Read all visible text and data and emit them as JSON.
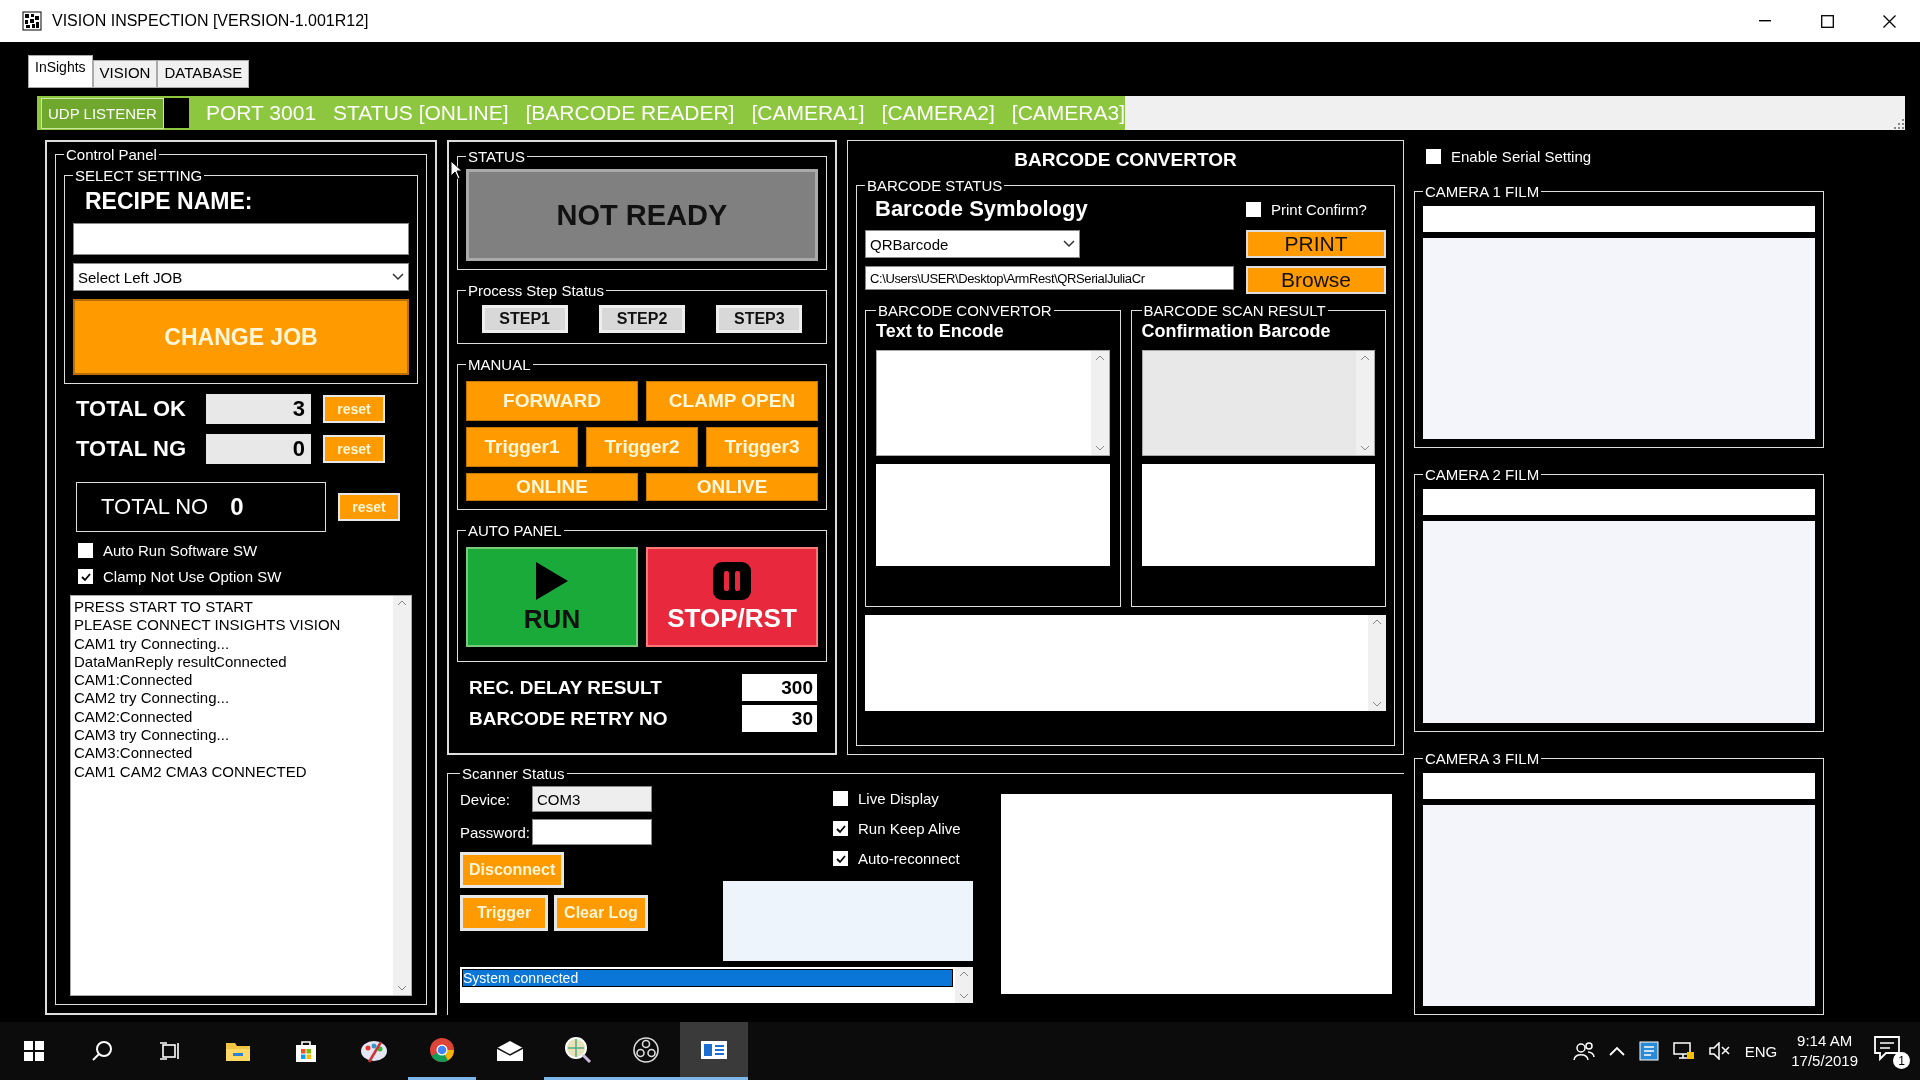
{
  "window": {
    "title": "VISION INSPECTION [VERSION-1.001R12]"
  },
  "tabs": [
    {
      "label": "InSights",
      "selected": true
    },
    {
      "label": "VISION",
      "selected": false
    },
    {
      "label": "DATABASE",
      "selected": false
    }
  ],
  "status_strip": {
    "badge": "UDP LISTENER",
    "items": [
      "PORT 3001",
      "STATUS [ONLINE]",
      "[BARCODE READER]",
      "[CAMERA1]",
      "[CAMERA2]",
      "[CAMERA3]"
    ]
  },
  "control_panel": {
    "title": "Control Panel",
    "select_setting": {
      "title": "SELECT SETTING",
      "recipe_label": "RECIPE NAME:",
      "job_select": "Select Left JOB",
      "change_job": "CHANGE JOB"
    },
    "counters": [
      {
        "label": "TOTAL OK",
        "value": "3",
        "reset": "reset"
      },
      {
        "label": "TOTAL NG",
        "value": "0",
        "reset": "reset"
      }
    ],
    "total_no": {
      "label": "TOTAL NO",
      "value": "0",
      "reset": "reset"
    },
    "options": [
      {
        "label": "Auto Run Software SW",
        "checked": false
      },
      {
        "label": "Clamp Not Use Option SW",
        "checked": true
      }
    ],
    "log": [
      "PRESS START TO START",
      "PLEASE CONNECT INSIGHTS VISION",
      "CAM1 try Connecting...",
      "DataManReply resultConnected",
      "CAM1:Connected",
      "CAM2 try Connecting...",
      "CAM2:Connected",
      "CAM3 try Connecting...",
      "CAM3:Connected",
      "CAM1 CAM2 CMA3 CONNECTED"
    ]
  },
  "status_panel": {
    "title": "STATUS",
    "status": "NOT READY",
    "process": {
      "title": "Process Step Status",
      "steps": [
        "STEP1",
        "STEP2",
        "STEP3"
      ]
    },
    "manual": {
      "title": "MANUAL",
      "rows": [
        [
          "FORWARD",
          "CLAMP OPEN"
        ],
        [
          "Trigger1",
          "Trigger2",
          "Trigger3"
        ],
        [
          "ONLINE",
          "ONLIVE"
        ]
      ]
    },
    "auto": {
      "title": "AUTO PANEL",
      "run": "RUN",
      "stop": "STOP/RST"
    },
    "settings": [
      {
        "label": "REC. DELAY RESULT",
        "value": "300"
      },
      {
        "label": "BARCODE RETRY NO",
        "value": "30"
      }
    ]
  },
  "barcode": {
    "title": "BARCODE CONVERTOR",
    "status_title": "BARCODE STATUS",
    "symbology_label": "Barcode Symbology",
    "print_confirm": {
      "label": "Print Confirm?",
      "checked": false
    },
    "symbology": "QRBarcode",
    "print": "PRINT",
    "path": "C:\\Users\\USER\\Desktop\\ArmRest\\QRSerialJuliaCr",
    "browse": "Browse",
    "convertor": {
      "title": "BARCODE CONVERTOR",
      "label": "Text to Encode"
    },
    "scan_result": {
      "title": "BARCODE SCAN RESULT",
      "label": "Confirmation Barcode"
    }
  },
  "serial": {
    "label": "Enable Serial Setting",
    "checked": false
  },
  "cameras": [
    {
      "title": "CAMERA 1 FILM"
    },
    {
      "title": "CAMERA 2 FILM"
    },
    {
      "title": "CAMERA 3 FILM"
    }
  ],
  "scanner": {
    "title": "Scanner Status",
    "device_label": "Device:",
    "device": "COM3",
    "password_label": "Password:",
    "disconnect": "Disconnect",
    "trigger": "Trigger",
    "clear_log": "Clear Log",
    "options": [
      {
        "label": "Live Display",
        "checked": false
      },
      {
        "label": "Run Keep Alive",
        "checked": true
      },
      {
        "label": "Auto-reconnect",
        "checked": true
      }
    ],
    "log": [
      {
        "text": "System connected",
        "selected": true
      }
    ]
  },
  "taskbar": {
    "apps": [
      {
        "kind": "start"
      },
      {
        "kind": "search"
      },
      {
        "kind": "task_view"
      },
      {
        "kind": "folder",
        "running": false,
        "selected": false
      },
      {
        "kind": "store",
        "running": false,
        "selected": false
      },
      {
        "kind": "palette",
        "running": false,
        "selected": false
      },
      {
        "kind": "browser",
        "running": true,
        "selected": false
      },
      {
        "kind": "mail",
        "running": false,
        "selected": false
      },
      {
        "kind": "globe",
        "running": true,
        "selected": false
      },
      {
        "kind": "disc",
        "running": true,
        "selected": false
      },
      {
        "kind": "window",
        "running": true,
        "selected": true
      }
    ],
    "tray": [
      {
        "kind": "people"
      },
      {
        "kind": "chevron"
      },
      {
        "kind": "app"
      },
      {
        "kind": "network"
      },
      {
        "kind": "volume_muted"
      }
    ],
    "language": "ENG",
    "time": "9:14 AM",
    "date": "17/5/2019",
    "notifications": "1"
  }
}
